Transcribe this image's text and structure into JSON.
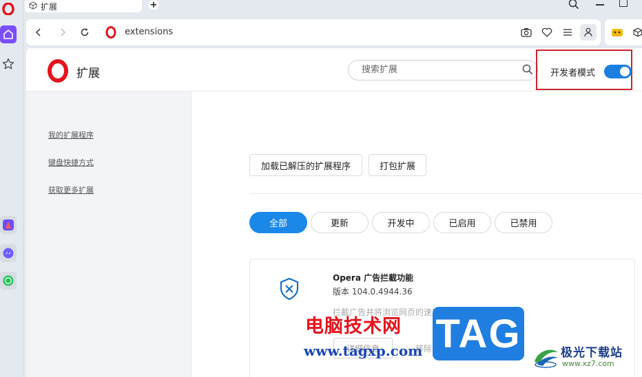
{
  "browser": {
    "tab_title": "扩展",
    "new_tab_symbol": "+",
    "url": "extensions"
  },
  "header": {
    "title": "扩展",
    "search_placeholder": "搜索扩展",
    "dev_mode_label": "开发者模式",
    "dev_mode_on": true
  },
  "left_nav": {
    "items": [
      "我的扩展程序",
      "键盘快捷方式",
      "获取更多扩展"
    ]
  },
  "actions": {
    "load_unpacked": "加载已解压的扩展程序",
    "pack": "打包扩展"
  },
  "filters": [
    {
      "label": "全部",
      "active": true
    },
    {
      "label": "更新",
      "active": false
    },
    {
      "label": "开发中",
      "active": false
    },
    {
      "label": "已启用",
      "active": false
    },
    {
      "label": "已禁用",
      "active": false
    }
  ],
  "extension": {
    "name": "Opera 广告拦截功能",
    "version": "版本 104.0.4944.36",
    "description": "拦截广告并将浏览网页的速度提升三倍。",
    "details_label": "详细信息",
    "remove_label": "移除",
    "disable_label": "禁用"
  },
  "watermarks": {
    "site_cn": "电脑技术网",
    "site_url": "www.tagxp.com",
    "tag": "TAG",
    "site2_cn": "极光下载站",
    "site2_url": "www.xz7.com"
  },
  "colors": {
    "accent": "#1a88e8",
    "opera_red": "#e4131c",
    "highlight_box": "#c8232b"
  }
}
